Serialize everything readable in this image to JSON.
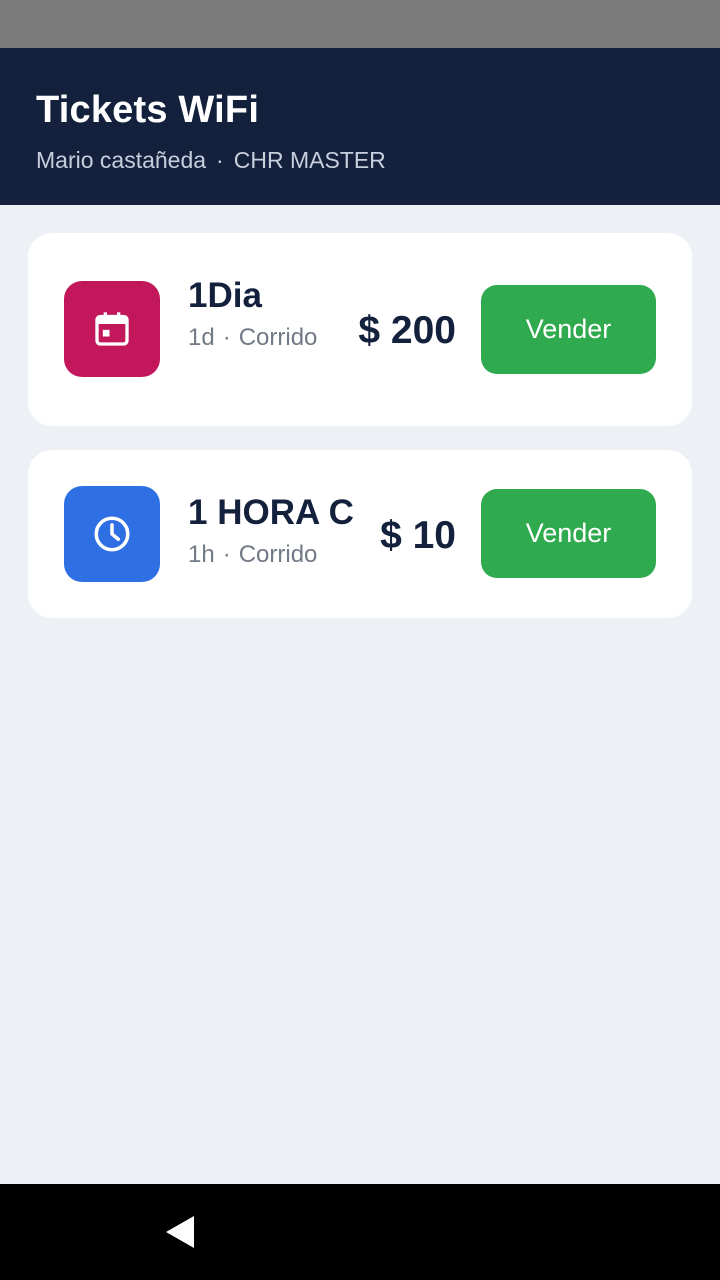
{
  "header": {
    "title": "Tickets WiFi",
    "user": "Mario castañeda",
    "separator": "·",
    "network": "CHR MASTER"
  },
  "tickets": [
    {
      "name": "1Dia",
      "duration": "1d",
      "separator": "·",
      "mode": "Corrido",
      "price": "$ 200",
      "action_label": "Vender",
      "icon": "calendar-icon",
      "icon_color": "#c2185b"
    },
    {
      "name": "1 HORA C",
      "duration": "1h",
      "separator": "·",
      "mode": "Corrido",
      "price": "$ 10",
      "action_label": "Vender",
      "icon": "clock-icon",
      "icon_color": "#2f6fe4"
    }
  ],
  "colors": {
    "header_bg": "#13213d",
    "page_bg": "#edf0f5",
    "sell_button": "#2faa4e"
  },
  "navigation": {
    "back_icon": "back-triangle-icon"
  }
}
